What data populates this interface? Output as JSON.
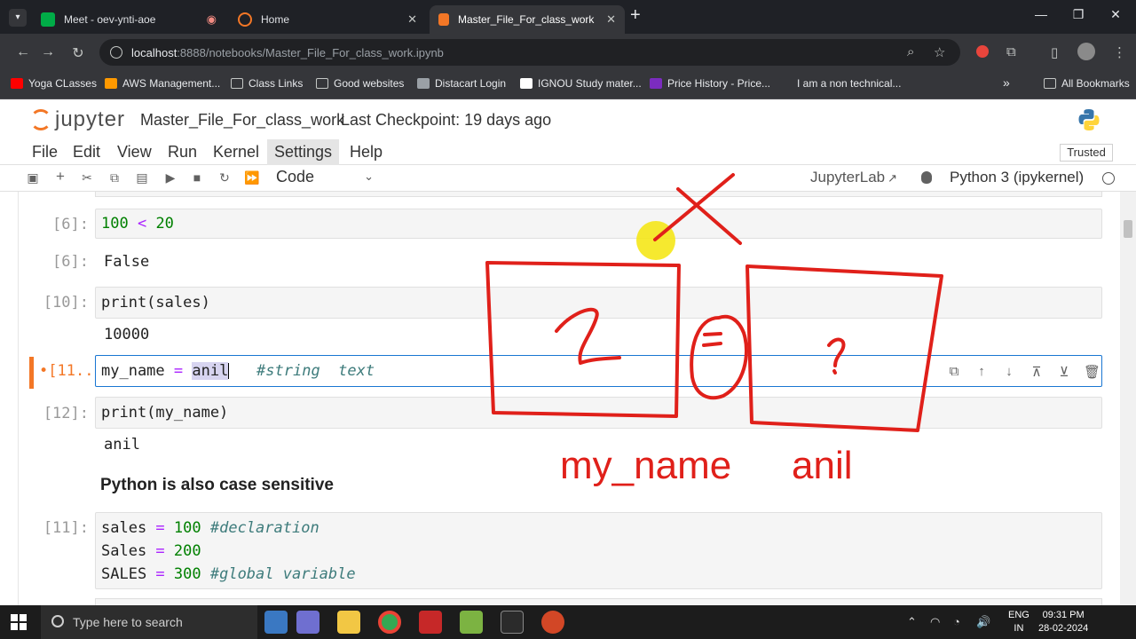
{
  "browser": {
    "tabs": [
      {
        "title": "Meet - oev-ynti-aoe",
        "color": "#00ac47"
      },
      {
        "title": "Home",
        "color": "#f37726"
      },
      {
        "title": "Master_File_For_class_work",
        "color": "#f37726",
        "active": true
      }
    ],
    "new_tab": "+",
    "address": {
      "host": "localhost",
      "path": ":8888/notebooks/Master_File_For_class_work.ipynb"
    },
    "bookmarks": [
      {
        "label": "Yoga CLasses",
        "color": "#ff0000"
      },
      {
        "label": "AWS Management...",
        "color": "#ff9900"
      },
      {
        "label": "Class Links",
        "color": "folder"
      },
      {
        "label": "Good websites",
        "color": "folder"
      },
      {
        "label": "Distacart Login",
        "color": "#9aa0a6"
      },
      {
        "label": "IGNOU Study mater...",
        "color": "#ffffff"
      },
      {
        "label": "Price History - Price...",
        "color": "#7b2cbf"
      },
      {
        "label": "I am a non technical...",
        "color": "#35363a"
      },
      {
        "label": "All Bookmarks",
        "color": "folder"
      }
    ],
    "overflow": "»"
  },
  "jupyter": {
    "logo_text": "jupyter",
    "notebook_name": "Master_File_For_class_work",
    "checkpoint": "Last Checkpoint: 19 days ago",
    "menu": [
      "File",
      "Edit",
      "View",
      "Run",
      "Kernel",
      "Settings",
      "Help"
    ],
    "trusted": "Trusted",
    "cell_type": "Code",
    "jupyterlab_link": "JupyterLab",
    "kernel": "Python 3 (ipykernel)"
  },
  "cells": {
    "c1": {
      "prompt": "[6]:",
      "code": {
        "a": "100",
        "op": " < ",
        "b": "20"
      },
      "out_prompt": "[6]:",
      "output": "False"
    },
    "c2": {
      "prompt": "[10]:",
      "code": "print(sales)",
      "output": "10000"
    },
    "c3": {
      "prompt": "[11...",
      "marker": "•",
      "code": {
        "var": "my_name",
        "eq": " = ",
        "val": "anil",
        "comment": "#string  text"
      }
    },
    "c4": {
      "prompt": "[12]:",
      "code": "print(my_name)",
      "output": "anil"
    },
    "markdown": "Python is also case sensitive",
    "c5": {
      "prompt": "[11]:",
      "lines": [
        {
          "var": "sales",
          "eq": " = ",
          "val": "100",
          "comment": " #declaration"
        },
        {
          "var": "Sales",
          "eq": " = ",
          "val": "200",
          "comment": ""
        },
        {
          "var": "SALES",
          "eq": " = ",
          "val": "300",
          "comment": " #global variable"
        }
      ]
    }
  },
  "annotation": {
    "var_label": "my_name",
    "value_label": "anil",
    "box1_mark": "2",
    "box2_mark": "?",
    "color": "#e0201a"
  },
  "taskbar": {
    "search_placeholder": "Type here to search",
    "lang": {
      "line1": "ENG",
      "line2": "IN"
    },
    "clock": {
      "time": "09:31 PM",
      "date": "28-02-2024"
    }
  }
}
